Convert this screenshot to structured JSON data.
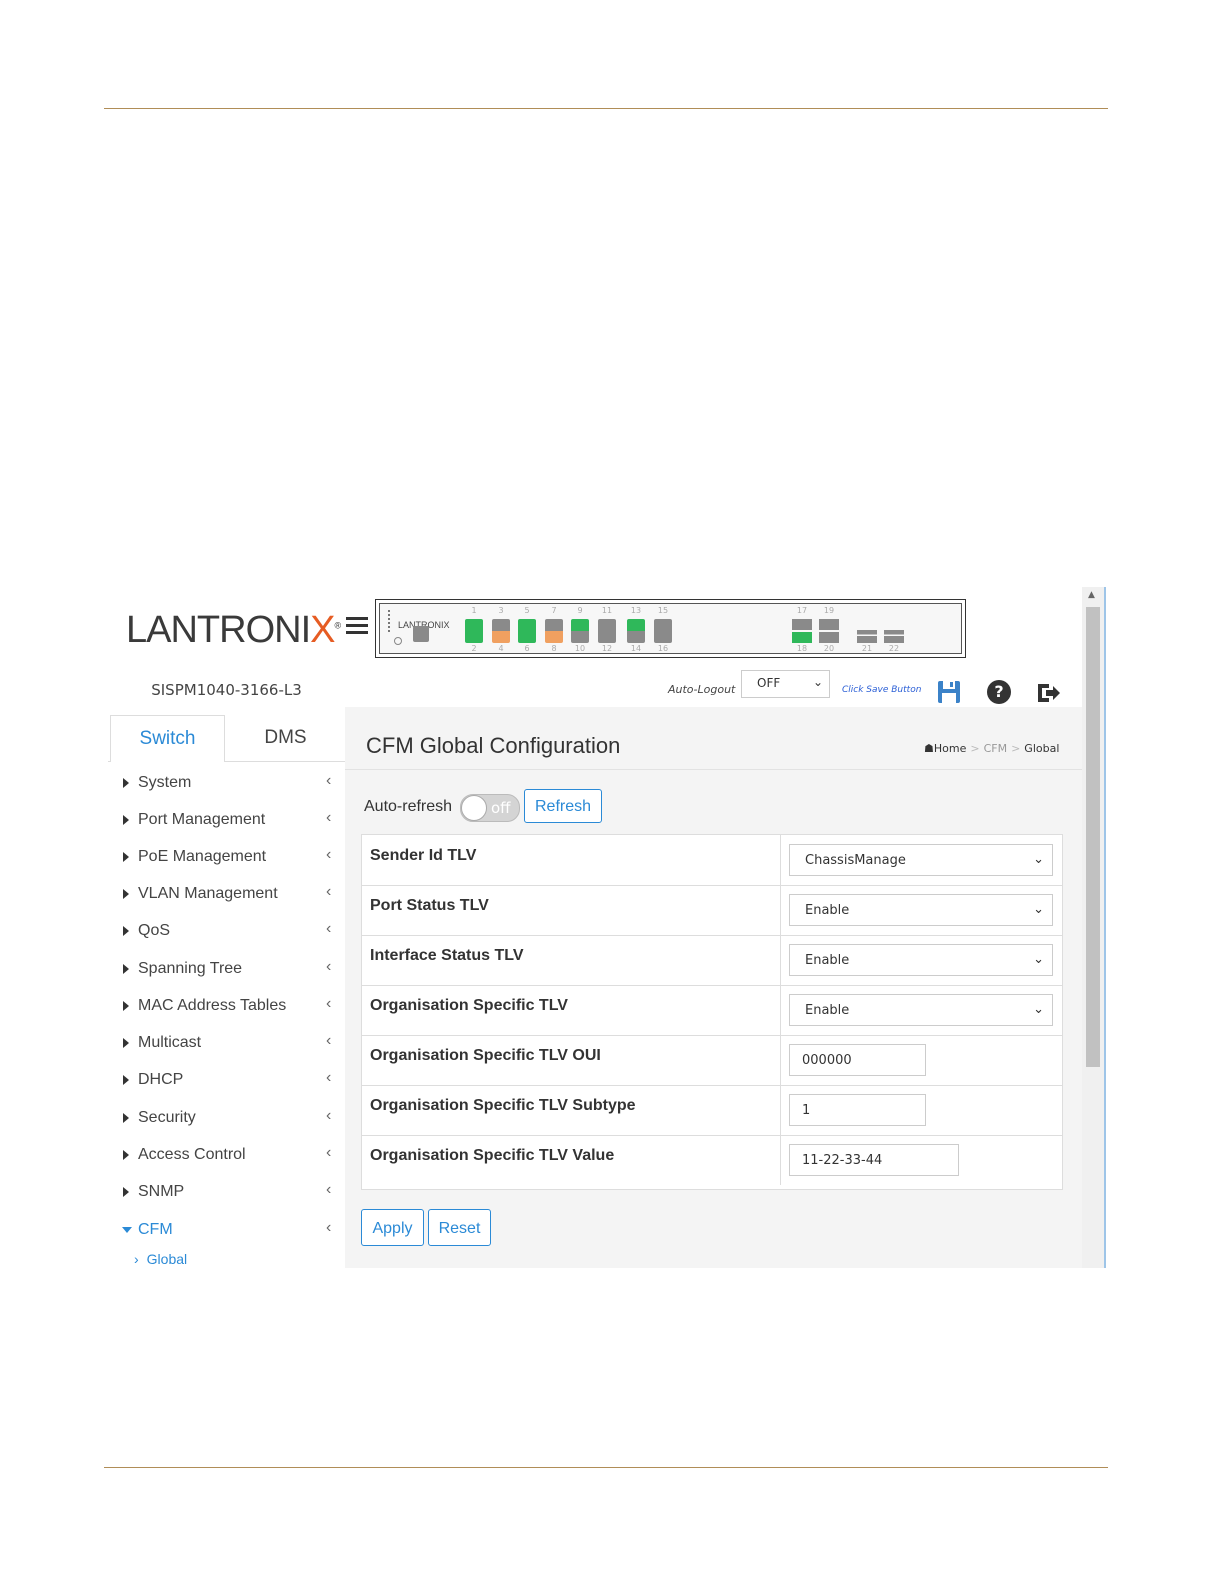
{
  "brand": {
    "logo_text_a": "LANTRONI",
    "logo_text_b": "X",
    "logo_reg": "®",
    "mini_logo": "LANTRONIX"
  },
  "device": {
    "name": "SISPM1040-3166-L3"
  },
  "tabs": [
    {
      "label": "Switch"
    },
    {
      "label": "DMS"
    }
  ],
  "nav": {
    "items": [
      {
        "label": "System"
      },
      {
        "label": "Port Management"
      },
      {
        "label": "PoE Management"
      },
      {
        "label": "VLAN Management"
      },
      {
        "label": "QoS"
      },
      {
        "label": "Spanning Tree"
      },
      {
        "label": "MAC Address Tables"
      },
      {
        "label": "Multicast"
      },
      {
        "label": "DHCP"
      },
      {
        "label": "Security"
      },
      {
        "label": "Access Control"
      },
      {
        "label": "SNMP"
      },
      {
        "label": "CFM"
      }
    ],
    "sub_item": "Global"
  },
  "ports": {
    "top_numbers": [
      "1",
      "3",
      "5",
      "7",
      "9",
      "11",
      "13",
      "15",
      "17",
      "19"
    ],
    "bottom_numbers": [
      "2",
      "4",
      "6",
      "8",
      "10",
      "12",
      "14",
      "16",
      "18",
      "20",
      "21",
      "22"
    ],
    "colors": {
      "green": "#2fb85a",
      "orange": "#f0a060",
      "gray": "#8a8a8a"
    }
  },
  "toolbar": {
    "auto_logout_label": "Auto-Logout",
    "auto_logout_value": "OFF",
    "save_hint": "Click Save Button",
    "icons": [
      "save-icon",
      "help-icon",
      "logout-icon"
    ]
  },
  "page": {
    "title": "CFM Global Configuration",
    "breadcrumb": {
      "home": "Home",
      "section": "CFM",
      "current": "Global"
    }
  },
  "refresh": {
    "auto_refresh_label": "Auto-refresh",
    "toggle_text": "off",
    "refresh_label": "Refresh"
  },
  "form": {
    "rows": [
      {
        "label": "Sender Id TLV",
        "value": "ChassisManage"
      },
      {
        "label": "Port Status TLV",
        "value": "Enable"
      },
      {
        "label": "Interface Status TLV",
        "value": "Enable"
      },
      {
        "label": "Organisation Specific TLV",
        "value": "Enable"
      },
      {
        "label": "Organisation Specific TLV OUI",
        "value": "000000"
      },
      {
        "label": "Organisation Specific TLV Subtype",
        "value": "1"
      },
      {
        "label": "Organisation Specific TLV Value",
        "value": "11-22-33-44"
      }
    ]
  },
  "actions": {
    "apply_label": "Apply",
    "reset_label": "Reset"
  },
  "colors": {
    "accent": "#2b8ad6",
    "rule": "#b08d57",
    "logo_x": "#e65c23"
  }
}
